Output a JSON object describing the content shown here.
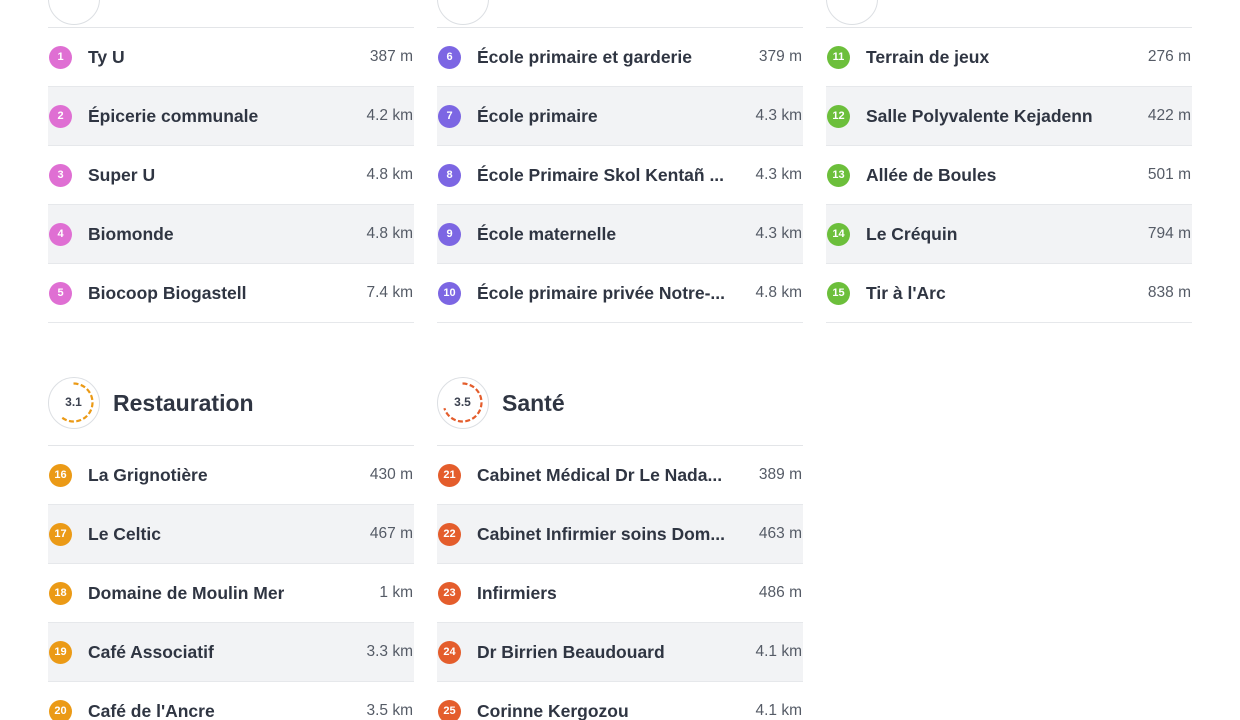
{
  "colors": {
    "commerces": "#df6fd3",
    "ecoles": "#7c66e3",
    "loisirs": "#6cbf3b",
    "restauration": "#eb9a16",
    "sante": "#e45d2c"
  },
  "sections": {
    "commerces": {
      "items": [
        {
          "num": "1",
          "name": "Ty U",
          "dist": "387 m"
        },
        {
          "num": "2",
          "name": "Épicerie communale",
          "dist": "4.2 km"
        },
        {
          "num": "3",
          "name": "Super U",
          "dist": "4.8 km"
        },
        {
          "num": "4",
          "name": "Biomonde",
          "dist": "4.8 km"
        },
        {
          "num": "5",
          "name": "Biocoop Biogastell",
          "dist": "7.4 km"
        }
      ]
    },
    "ecoles": {
      "items": [
        {
          "num": "6",
          "name": "École primaire et garderie",
          "dist": "379 m"
        },
        {
          "num": "7",
          "name": "École primaire",
          "dist": "4.3 km"
        },
        {
          "num": "8",
          "name": "École Primaire Skol Kentañ ...",
          "dist": "4.3 km"
        },
        {
          "num": "9",
          "name": "École maternelle",
          "dist": "4.3 km"
        },
        {
          "num": "10",
          "name": "École primaire privée Notre-...",
          "dist": "4.8 km"
        }
      ]
    },
    "loisirs": {
      "items": [
        {
          "num": "11",
          "name": "Terrain de jeux",
          "dist": "276 m"
        },
        {
          "num": "12",
          "name": "Salle Polyvalente Kejadenn",
          "dist": "422 m"
        },
        {
          "num": "13",
          "name": "Allée de Boules",
          "dist": "501 m"
        },
        {
          "num": "14",
          "name": "Le Créquin",
          "dist": "794 m"
        },
        {
          "num": "15",
          "name": "Tir à l'Arc",
          "dist": "838 m"
        }
      ]
    },
    "restauration": {
      "title": "Restauration",
      "score": "3.1",
      "score_fraction": 0.62,
      "items": [
        {
          "num": "16",
          "name": "La Grignotière",
          "dist": "430 m"
        },
        {
          "num": "17",
          "name": "Le Celtic",
          "dist": "467 m"
        },
        {
          "num": "18",
          "name": "Domaine de Moulin Mer",
          "dist": "1 km"
        },
        {
          "num": "19",
          "name": "Café Associatif",
          "dist": "3.3 km"
        },
        {
          "num": "20",
          "name": "Café de l'Ancre",
          "dist": "3.5 km"
        }
      ]
    },
    "sante": {
      "title": "Santé",
      "score": "3.5",
      "score_fraction": 0.7,
      "items": [
        {
          "num": "21",
          "name": "Cabinet Médical Dr Le Nada...",
          "dist": "389 m"
        },
        {
          "num": "22",
          "name": "Cabinet Infirmier soins Dom...",
          "dist": "463 m"
        },
        {
          "num": "23",
          "name": "Infirmiers",
          "dist": "486 m"
        },
        {
          "num": "24",
          "name": "Dr Birrien Beaudouard",
          "dist": "4.1 km"
        },
        {
          "num": "25",
          "name": "Corinne Kergozou",
          "dist": "4.1 km"
        }
      ]
    }
  }
}
